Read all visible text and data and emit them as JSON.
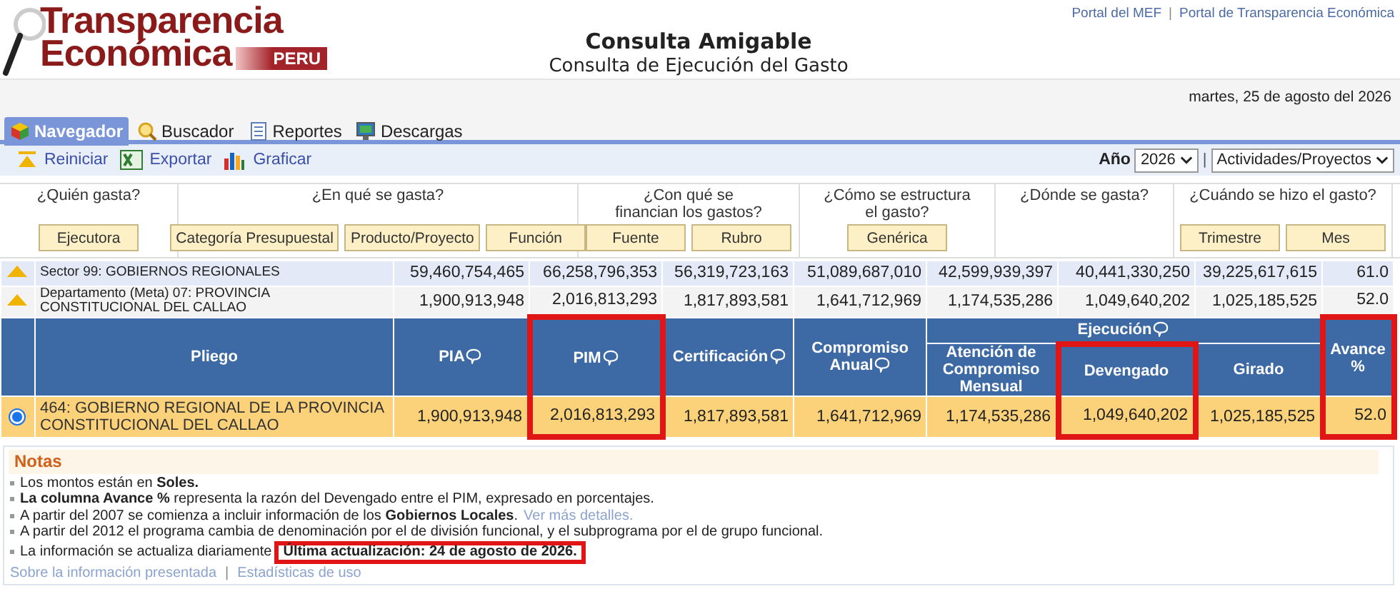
{
  "header": {
    "logo": {
      "line1": "Transparencia",
      "line2": "Económica",
      "badge": "PERU"
    },
    "title": "Consulta Amigable",
    "subtitle": "Consulta de Ejecución del Gasto",
    "links": [
      "Portal del MEF",
      "Portal de Transparencia Económica"
    ],
    "separator": "|",
    "date": "martes, 25 de agosto del 2026"
  },
  "tabs": [
    {
      "label": "Navegador",
      "selected": true
    },
    {
      "label": "Buscador",
      "selected": false
    },
    {
      "label": "Reportes",
      "selected": false
    },
    {
      "label": "Descargas",
      "selected": false
    }
  ],
  "toolbar": {
    "actions": [
      "Reiniciar",
      "Exportar",
      "Graficar"
    ],
    "year_label": "Año",
    "year": "2026",
    "separator": "|",
    "view": "Actividades/Proyectos"
  },
  "questions": [
    {
      "question": "¿Quién gasta?",
      "buttons": [
        "Ejecutora"
      ]
    },
    {
      "question": "¿En qué se gasta?",
      "buttons": [
        "Categoría Presupuestal",
        "Producto/Proyecto",
        "Función"
      ]
    },
    {
      "question": "¿Con qué se\nfinancian los gastos?",
      "buttons": [
        "Fuente",
        "Rubro"
      ]
    },
    {
      "question": "¿Cómo se estructura\nel gasto?",
      "buttons": [
        "Genérica"
      ]
    },
    {
      "question": "¿Dónde se gasta?"
    },
    {
      "question": "¿Cuándo se hizo el gasto?",
      "buttons": [
        "Trimestre",
        "Mes"
      ]
    }
  ],
  "summary_rows": [
    {
      "label": "Sector 99: GOBIERNOS REGIONALES",
      "values": [
        "59,460,754,465",
        "66,258,796,353",
        "56,319,723,163",
        "51,089,687,010",
        "42,599,939,397",
        "40,441,330,250",
        "39,225,617,615",
        "61.0"
      ]
    },
    {
      "label": "Departamento (Meta) 07: PROVINCIA CONSTITUCIONAL DEL CALLAO",
      "values": [
        "1,900,913,948",
        "2,016,813,293",
        "1,817,893,581",
        "1,641,712,969",
        "1,174,535,286",
        "1,049,640,202",
        "1,025,185,525",
        "52.0"
      ]
    }
  ],
  "table": {
    "group": {
      "label": "Ejecución",
      "info": true
    },
    "columns": [
      {
        "label": "Pliego",
        "kind": "plain",
        "info": false,
        "highlighted": false
      },
      {
        "label": "PIA",
        "kind": "plain",
        "info": true,
        "highlighted": false
      },
      {
        "label": "PIM",
        "kind": "plain",
        "info": true,
        "highlighted": true
      },
      {
        "label": "Certificación",
        "kind": "plain",
        "info": true,
        "highlighted": false
      },
      {
        "label": "Compromiso Anual",
        "kind": "plain",
        "info": true,
        "highlighted": false
      },
      {
        "label": "Atención de Compromiso Mensual",
        "kind": "grouped",
        "info": false,
        "highlighted": false
      },
      {
        "label": "Devengado",
        "kind": "grouped",
        "info": false,
        "highlighted": true
      },
      {
        "label": "Girado",
        "kind": "grouped",
        "info": false,
        "highlighted": false
      },
      {
        "label": "Avance %",
        "kind": "plain",
        "info": false,
        "highlighted": true
      }
    ],
    "rows": [
      {
        "selected": true,
        "cells": [
          "464: GOBIERNO REGIONAL DE LA PROVINCIA CONSTITUCIONAL DEL CALLAO",
          "1,900,913,948",
          "2,016,813,293",
          "1,817,893,581",
          "1,641,712,969",
          "1,174,535,286",
          "1,049,640,202",
          "1,025,185,525",
          "52.0"
        ]
      }
    ]
  },
  "notes": {
    "title": "Notas",
    "items": [
      {
        "text": "Los montos están en **Soles.**"
      },
      {
        "text": "**La columna Avance %** representa la razón del Devengado entre el PIM, expresado en porcentajes."
      },
      {
        "text": "A partir del 2007 se comienza a incluir información de los **Gobiernos Locales**.",
        "link": "Ver más detalles."
      },
      {
        "text": "A partir del 2012 el programa cambia de denominación por el de división funcional, y el subprograma por el de grupo funcional."
      },
      {
        "text": "La información se actualiza diariamente",
        "highlight": "Última actualización: 24 de agosto de 2026."
      }
    ],
    "links": [
      "Sobre la información presentada",
      "Estadísticas de uso"
    ],
    "separator": "|"
  }
}
